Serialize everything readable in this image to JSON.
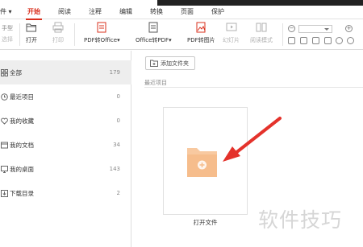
{
  "menu": {
    "file_fragment": "件 ▾",
    "tabs": [
      "开始",
      "阅读",
      "注释",
      "编辑",
      "转换",
      "页面",
      "保护"
    ]
  },
  "toolbar": {
    "hand_label": "手型",
    "select_label": "选择",
    "open_label": "打开",
    "print_label": "打印",
    "pdf_to_office_label": "PDF转Office▾",
    "office_to_pdf_label": "Office转PDF▾",
    "pdf_to_image_label": "PDF转图片",
    "slideshow_label": "幻灯片",
    "reading_mode_label": "阅读模式"
  },
  "sidebar": {
    "items": [
      {
        "label": "全部",
        "count": "179",
        "icon": "grid-icon"
      },
      {
        "label": "最近项目",
        "count": "0",
        "icon": "clock-icon"
      },
      {
        "label": "我的收藏",
        "count": "0",
        "icon": "heart-icon"
      },
      {
        "label": "我的文档",
        "count": "34",
        "icon": "document-icon"
      },
      {
        "label": "我的桌面",
        "count": "143",
        "icon": "desktop-icon"
      },
      {
        "label": "下载目录",
        "count": "2",
        "icon": "download-icon"
      }
    ]
  },
  "main": {
    "add_folder_label": "添加文件夹",
    "recent_label": "最近项目",
    "open_file_label": "打开文件"
  },
  "watermark": "软件技巧",
  "colors": {
    "accent": "#d9301e",
    "folder": "#f8c9a0",
    "arrow": "#e4322b"
  }
}
